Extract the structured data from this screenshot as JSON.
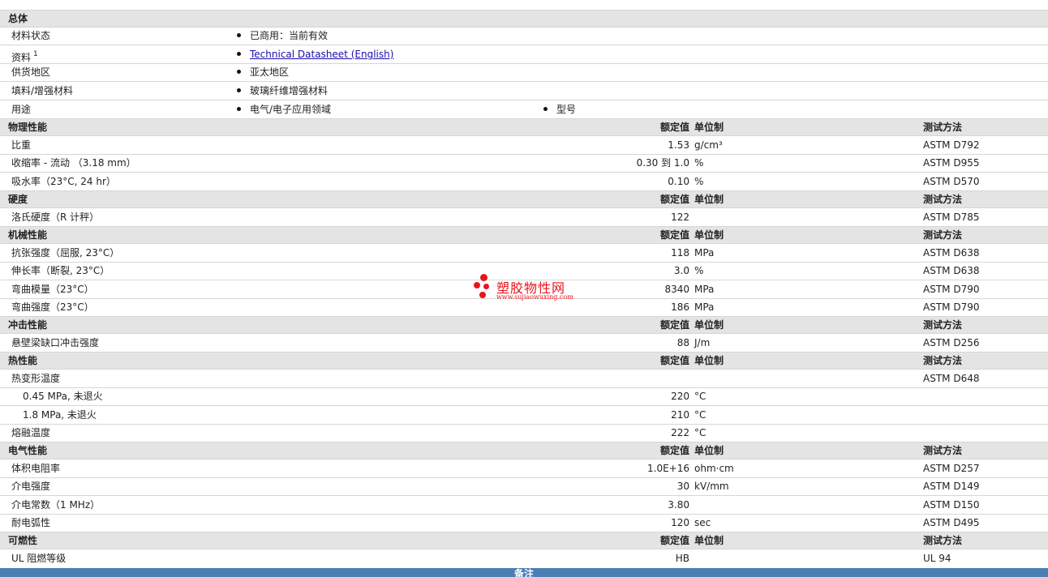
{
  "sections": {
    "general": {
      "title": "总体",
      "rows": {
        "status": {
          "label": "材料状态",
          "value": "已商用：当前有效"
        },
        "docs": {
          "label": "资料",
          "sup": "1",
          "link": "Technical Datasheet (English)"
        },
        "region": {
          "label": "供货地区",
          "value": "亚太地区"
        },
        "filler": {
          "label": "填料/增强材料",
          "value": "玻璃纤维增强材料"
        },
        "uses": {
          "label": "用途",
          "value1": "电气/电子应用领域",
          "value2": "型号"
        }
      }
    },
    "physical": {
      "title": "物理性能",
      "h_val": "额定值",
      "h_unit": "单位制",
      "h_test": "测试方法",
      "rows": [
        {
          "label": "比重",
          "value": "1.53",
          "unit": "g/cm³",
          "test": "ASTM D792"
        },
        {
          "label": "收缩率  - 流动 （3.18 mm）",
          "value": "0.30 到  1.0",
          "unit": "%",
          "test": "ASTM D955"
        },
        {
          "label": "吸水率（23°C, 24 hr）",
          "value": "0.10",
          "unit": "%",
          "test": "ASTM D570"
        }
      ]
    },
    "hardness": {
      "title": "硬度",
      "h_val": "额定值",
      "h_unit": "单位制",
      "h_test": "测试方法",
      "rows": [
        {
          "label": "洛氏硬度（R 计秤）",
          "value": "122",
          "unit": "",
          "test": "ASTM D785"
        }
      ]
    },
    "mechanical": {
      "title": "机械性能",
      "h_val": "额定值",
      "h_unit": "单位制",
      "h_test": "测试方法",
      "rows": [
        {
          "label": "抗张强度（屈服, 23°C）",
          "value": "118",
          "unit": "MPa",
          "test": "ASTM D638"
        },
        {
          "label": "伸长率（断裂, 23°C）",
          "value": "3.0",
          "unit": "%",
          "test": "ASTM D638"
        },
        {
          "label": "弯曲模量（23°C）",
          "value": "8340",
          "unit": "MPa",
          "test": "ASTM D790"
        },
        {
          "label": "弯曲强度（23°C）",
          "value": "186",
          "unit": "MPa",
          "test": "ASTM D790"
        }
      ]
    },
    "impact": {
      "title": "冲击性能",
      "h_val": "额定值",
      "h_unit": "单位制",
      "h_test": "测试方法",
      "rows": [
        {
          "label": "悬壁梁缺口冲击强度",
          "value": "88",
          "unit": "J/m",
          "test": "ASTM D256"
        }
      ]
    },
    "thermal": {
      "title": "热性能",
      "h_val": "额定值",
      "h_unit": "单位制",
      "h_test": "测试方法",
      "rows": [
        {
          "label": "热变形温度",
          "value": "",
          "unit": "",
          "test": "ASTM D648"
        },
        {
          "label": "0.45 MPa, 未退火",
          "value": "220",
          "unit": "°C",
          "test": "",
          "sub": true
        },
        {
          "label": "1.8 MPa, 未退火",
          "value": "210",
          "unit": "°C",
          "test": "",
          "sub": true
        },
        {
          "label": "熔融温度",
          "value": "222",
          "unit": "°C",
          "test": ""
        }
      ]
    },
    "electrical": {
      "title": "电气性能",
      "h_val": "额定值",
      "h_unit": "单位制",
      "h_test": "测试方法",
      "rows": [
        {
          "label": "体积电阻率",
          "value": "1.0E+16",
          "unit": "ohm·cm",
          "test": "ASTM D257"
        },
        {
          "label": "介电强度",
          "value": "30",
          "unit": "kV/mm",
          "test": "ASTM D149"
        },
        {
          "label": "介电常数（1 MHz）",
          "value": "3.80",
          "unit": "",
          "test": "ASTM D150"
        },
        {
          "label": "耐电弧性",
          "value": "120",
          "unit": "sec",
          "test": "ASTM D495"
        }
      ]
    },
    "flammability": {
      "title": "可燃性",
      "h_val": "额定值",
      "h_unit": "单位制",
      "h_test": "测试方法",
      "rows": [
        {
          "label": "UL 阻燃等级",
          "value": "HB",
          "unit": "",
          "test": "UL 94"
        }
      ]
    }
  },
  "footer": {
    "title": "备注"
  },
  "watermark": {
    "name": "塑胶物性网",
    "url": "www.sujiaowuxing.com",
    "color": "#e8141c"
  }
}
